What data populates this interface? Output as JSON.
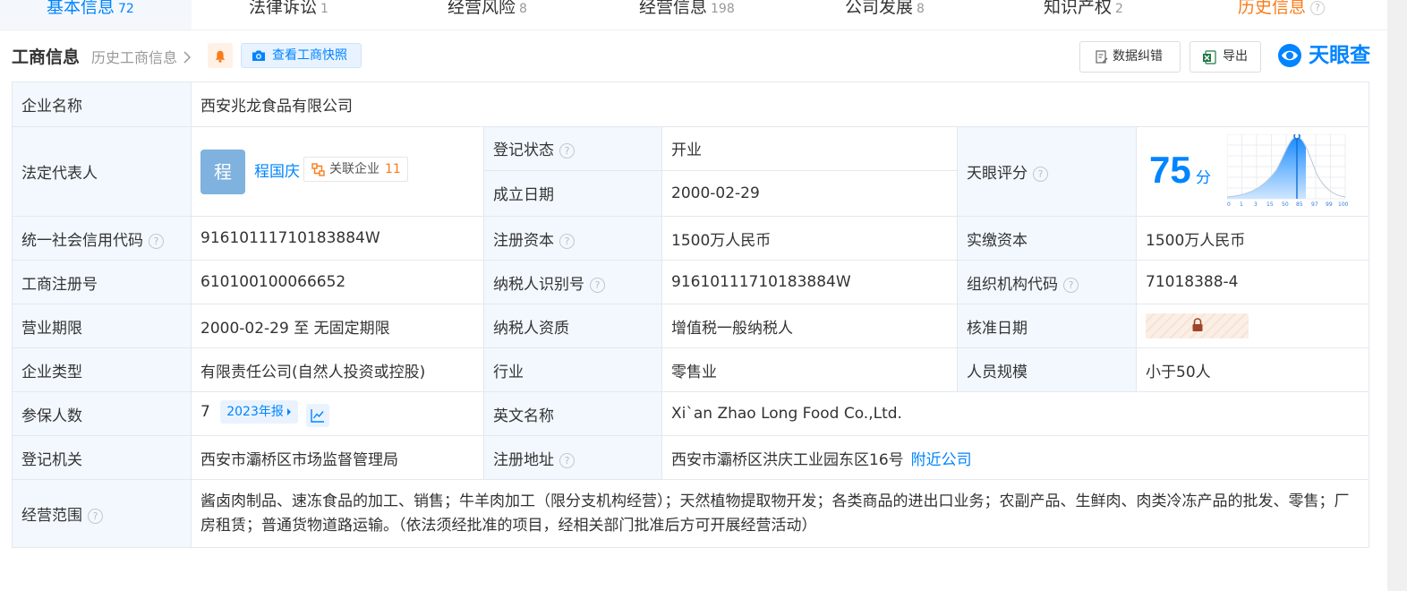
{
  "tabs": [
    {
      "label": "基本信息",
      "count": "72",
      "active": true
    },
    {
      "label": "法律诉讼",
      "count": "1"
    },
    {
      "label": "经营风险",
      "count": "8"
    },
    {
      "label": "经营信息",
      "count": "198"
    },
    {
      "label": "公司发展",
      "count": "8"
    },
    {
      "label": "知识产权",
      "count": "2"
    },
    {
      "label": "历史信息",
      "count": "?"
    }
  ],
  "header": {
    "title": "工商信息",
    "history_link": "历史工商信息",
    "snapshot_button": "查看工商快照",
    "correction_button": "数据纠错",
    "export_button": "导出",
    "logo_text": "天眼查"
  },
  "company": {
    "name_label": "企业名称",
    "name": "西安兆龙食品有限公司",
    "legal_rep_label": "法定代表人",
    "legal_rep_avatar": "程",
    "legal_rep": "程国庆",
    "related_label": "关联企业",
    "related_count": "11",
    "reg_status_label": "登记状态",
    "reg_status": "开业",
    "founded_label": "成立日期",
    "founded": "2000-02-29",
    "score_label": "天眼评分",
    "score": "75",
    "score_unit": "分",
    "score_ticks": [
      "0",
      "1",
      "3",
      "15",
      "50",
      "85",
      "97",
      "99",
      "100"
    ],
    "credit_code_label": "统一社会信用代码",
    "credit_code": "91610111710183884W",
    "reg_capital_label": "注册资本",
    "reg_capital": "1500万人民币",
    "paid_capital_label": "实缴资本",
    "paid_capital": "1500万人民币",
    "reg_no_label": "工商注册号",
    "reg_no": "610100100066652",
    "taxpayer_id_label": "纳税人识别号",
    "taxpayer_id": "91610111710183884W",
    "org_code_label": "组织机构代码",
    "org_code": "71018388-4",
    "term_label": "营业期限",
    "term": "2000-02-29 至 无固定期限",
    "taxpayer_qual_label": "纳税人资质",
    "taxpayer_qual": "增值税一般纳税人",
    "approve_date_label": "核准日期",
    "type_label": "企业类型",
    "type": "有限责任公司(自然人投资或控股)",
    "industry_label": "行业",
    "industry": "零售业",
    "staff_label": "人员规模",
    "staff": "小于50人",
    "insured_label": "参保人数",
    "insured": "7",
    "annual_report": "2023年报",
    "english_name_label": "英文名称",
    "english_name": "Xi`an Zhao Long Food Co.,Ltd.",
    "authority_label": "登记机关",
    "authority": "西安市灞桥区市场监督管理局",
    "address_label": "注册地址",
    "address": "西安市灞桥区洪庆工业园东区16号",
    "nearby_link": "附近公司",
    "scope_label": "经营范围",
    "scope": "酱卤肉制品、速冻食品的加工、销售；牛羊肉加工（限分支机构经营）；天然植物提取物开发；各类商品的进出口业务；农副产品、生鲜肉、肉类冷冻产品的批发、零售；厂房租赁；普通货物道路运输。（依法须经批准的项目，经相关部门批准后方可开展经营活动）"
  },
  "colors": {
    "accent": "#0084ff",
    "history_tab": "#fa7b18",
    "status_open": "#24a148",
    "label_bg": "#f2f8fe"
  }
}
